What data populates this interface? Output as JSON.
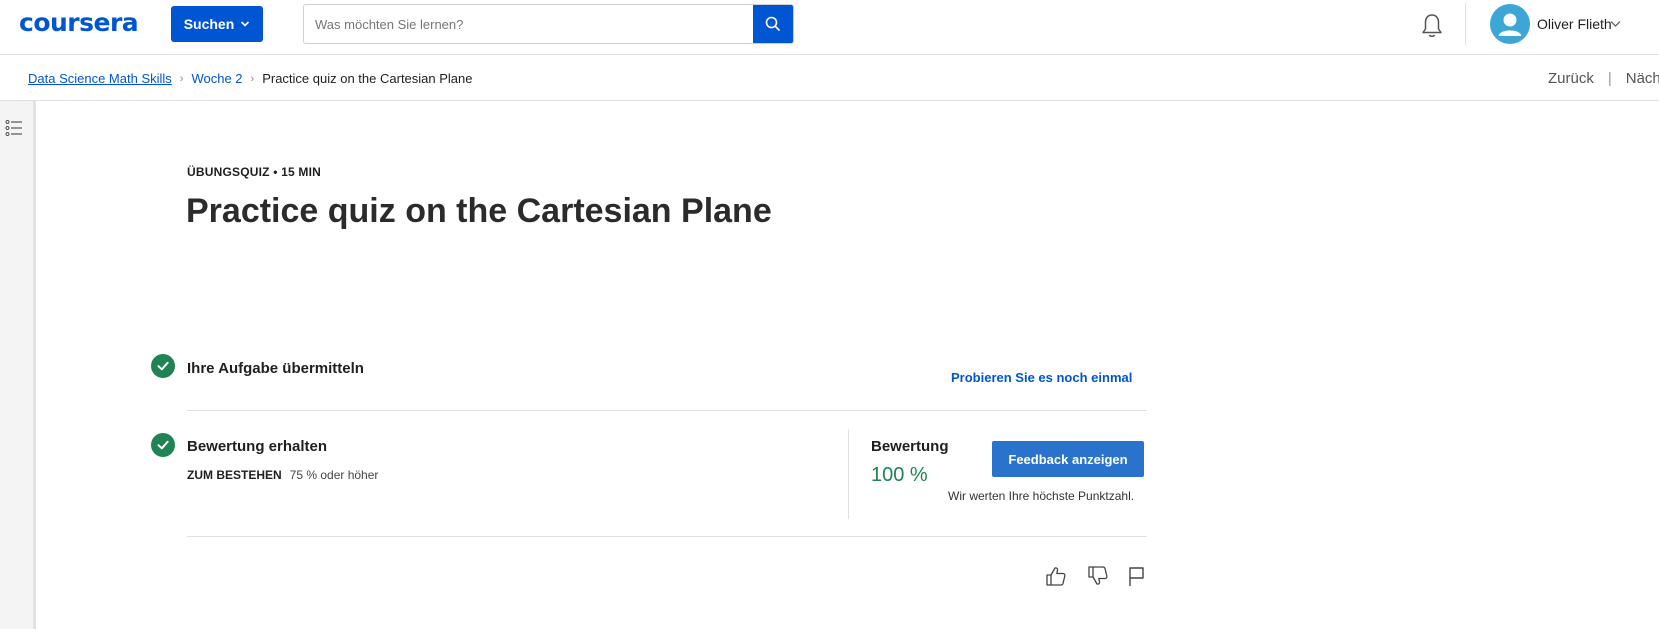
{
  "header": {
    "logo_text": "coursera",
    "search_button_label": "Suchen",
    "search_placeholder": "Was möchten Sie lernen?",
    "user_name": "Oliver Flieth",
    "brand_color": "#0056d2"
  },
  "breadcrumb": {
    "items": [
      "Data Science Math Skills",
      "Woche 2",
      "Practice quiz on the Cartesian Plane"
    ],
    "back_label": "Zurück",
    "next_label": "Näch"
  },
  "quiz": {
    "eyebrow": "ÜBUNGSQUIZ • 15 MIN",
    "title": "Practice quiz on the Cartesian Plane",
    "submit_step_label": "Ihre Aufgabe übermitteln",
    "retry_label": "Probieren Sie es noch einmal",
    "grade_step_label": "Bewertung erhalten",
    "pass_label": "ZUM BESTEHEN",
    "pass_value": "75 % oder höher",
    "grade_label": "Bewertung",
    "grade_value": "100 %",
    "feedback_button_label": "Feedback anzeigen",
    "grade_note": "Wir werten Ihre höchste Punktzahl.",
    "success_color": "#1f8354"
  },
  "icons": {
    "search": "search-icon",
    "bell": "bell-icon",
    "avatar": "avatar-icon",
    "chevron": "chevron-down-icon",
    "outline": "list-icon",
    "like": "thumbs-up-icon",
    "dislike": "thumbs-down-icon",
    "flag": "flag-icon"
  }
}
